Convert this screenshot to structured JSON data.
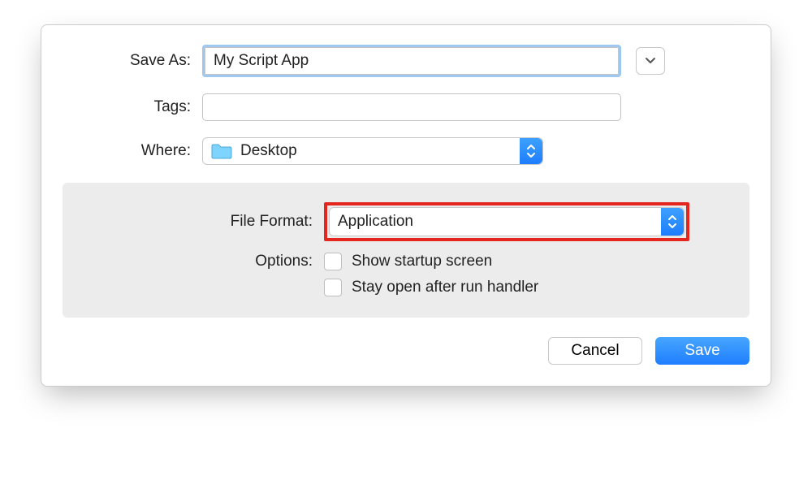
{
  "form": {
    "save_as_label": "Save As:",
    "save_as_value": "My Script App",
    "tags_label": "Tags:",
    "tags_value": "",
    "where_label": "Where:",
    "where_value": "Desktop"
  },
  "panel": {
    "file_format_label": "File Format:",
    "file_format_value": "Application",
    "options_label": "Options:",
    "option_startup": "Show startup screen",
    "option_stay_open": "Stay open after run handler"
  },
  "footer": {
    "cancel": "Cancel",
    "save": "Save"
  }
}
